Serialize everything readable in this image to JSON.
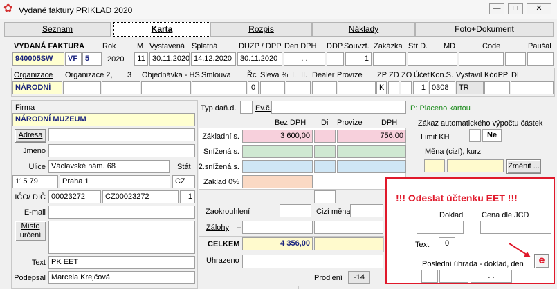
{
  "window": {
    "title": "Vydané faktury PRIKLAD  2020",
    "minimize": "—",
    "maximize": "□",
    "close": "✕"
  },
  "tabs": [
    {
      "label": "Seznam"
    },
    {
      "label": "Karta"
    },
    {
      "label": "Rozpis"
    },
    {
      "label": "Náklady"
    },
    {
      "label": "Foto+Dokument"
    }
  ],
  "header": {
    "labels": {
      "title": "VYDANÁ FAKTURA",
      "rok": "Rok",
      "m": "M",
      "vystavena": "Vystavená",
      "splatna": "Splatná",
      "duzp": "DUZP / DPP",
      "den_dph": "Den DPH",
      "ddp": "DDP",
      "souvzt": "Souvzt.",
      "zakazka": "Zakázka",
      "strd": "Stř.D.",
      "md": "MD",
      "code": "Code",
      "pausal": "Paušál"
    },
    "values": {
      "doc_no": "940005SW",
      "series": "VF",
      "series_no": "5",
      "rok": "2020",
      "m": "11",
      "vystavena": "30.11.2020",
      "splatna": "14.12.2020",
      "duzp": "30.11.2020",
      "den_dph": ". .",
      "souvzt": "1"
    }
  },
  "org": {
    "labels": {
      "org": "Organizace",
      "org2": "Organizace 2,",
      "three": "3",
      "objednavka": "Objednávka - HS",
      "smlouva": "Smlouva",
      "rc": "Řc",
      "sleva": "Sleva %",
      "i": "I.",
      "ii": "II.",
      "dealer": "Dealer",
      "provize": "Provize",
      "zp": "ZP",
      "zd": "ZD",
      "zo": "ZO",
      "ucet": "Účet",
      "kons": "Kon.S.",
      "vystavil": "Vystavil",
      "kodpp": "KódPP",
      "dl": "DL"
    },
    "values": {
      "org": "NÁRODNÍ",
      "rc": "0",
      "zp": "K",
      "ucet": "1",
      "kons": "0308",
      "vystavil": "TR"
    }
  },
  "firma": {
    "labels": {
      "firma": "Firma",
      "adresa": "Adresa",
      "jmeno": "Jméno",
      "ulice": "Ulice",
      "stat": "Stát",
      "ico": "IČO/ DIČ",
      "email": "E-mail",
      "misto": "Místo",
      "urceni": "určení",
      "text": "Text",
      "podpis": "Podepsal"
    },
    "values": {
      "firma": "NÁRODNÍ MUZEUM",
      "ulice": "Václavské nám. 68",
      "psc": "115 79",
      "mesto": "Praha 1",
      "stat": "CZ",
      "ico": "00023272",
      "dic": "CZ00023272",
      "ico_n": "1",
      "text": "PK EET",
      "podpis": "Marcela Krejčová"
    }
  },
  "amounts": {
    "labels": {
      "typ": "Typ daň.d.",
      "ev": "Ev.č.",
      "placeno": "P: Placeno kartou",
      "bez_dph": "Bez DPH",
      "di": "Di",
      "provize": "Provize",
      "dph": "DPH",
      "zakladni": "Základní s.",
      "snizena": "Snížená s.",
      "snizena2": "2.snížená s.",
      "zaklad0": "Základ 0%",
      "zaokrouhleni": "Zaokrouhlení",
      "cizi_mena": "Cizí měna",
      "zalohy": "Zálohy",
      "zalohy_dash": "–",
      "celkem": "CELKEM",
      "uhrazeno": "Uhrazeno",
      "prodleni": "Prodlení"
    },
    "values": {
      "zakladni_bez": "3 600,00",
      "zakladni_dph": "756,00",
      "celkem": "4 356,00",
      "prodleni": "-14"
    }
  },
  "right": {
    "labels": {
      "zakaz": "Zákaz automatického výpočtu částek",
      "limit": "Limit KH",
      "mena": "Měna (cizí), kurz",
      "zmenit": "Změnit ..."
    },
    "values": {
      "ne": "Ne"
    }
  },
  "eet": {
    "labels": {
      "warning": "!!! Odeslat účtenku EET !!!",
      "doklad": "Doklad",
      "cena": "Cena dle JCD",
      "text": "Text",
      "posledni": "Poslední úhrada - doklad, den"
    },
    "values": {
      "text_n": "0",
      "den": ". ."
    },
    "icon": "e"
  },
  "colors": {
    "accent": "#e0192b",
    "title": "#1a237e",
    "green": "#1a8a1a"
  }
}
